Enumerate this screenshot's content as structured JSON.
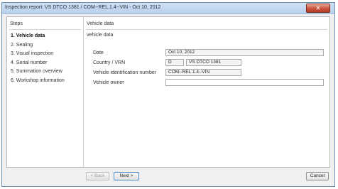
{
  "window": {
    "title": "Inspection report: VS DTCO 1381 / COM--REL.1.4--VIN - Oct 10, 2012",
    "close_glyph": "✕"
  },
  "steps": {
    "header": "Steps",
    "items": [
      {
        "label": "1. Vehicle data",
        "active": true
      },
      {
        "label": "2. Sealing",
        "active": false
      },
      {
        "label": "3. Visual inspection",
        "active": false
      },
      {
        "label": "4. Serial number",
        "active": false
      },
      {
        "label": "5. Summation overview",
        "active": false
      },
      {
        "label": "6. Workshop information",
        "active": false
      }
    ]
  },
  "content": {
    "header": "Vehicle data",
    "subtitle": "vehicle data",
    "fields": {
      "date": {
        "label": "Date",
        "value": "Oct 10, 2012"
      },
      "country_vrn": {
        "label": "Country / VRN",
        "country": "D",
        "vrn": "VS DTCO 1381"
      },
      "vin": {
        "label": "Vehicle identification number",
        "value": "COM--REL.1.4--VIN"
      },
      "owner": {
        "label": "Vehicle  owner",
        "value": ""
      }
    }
  },
  "footer": {
    "back_label": "< Back",
    "next_label": "Next >",
    "cancel_label": "Cancel"
  },
  "colors": {
    "titlebar": "#b8d1ec",
    "close": "#c9543e",
    "accent_border": "#4a8fd0"
  }
}
